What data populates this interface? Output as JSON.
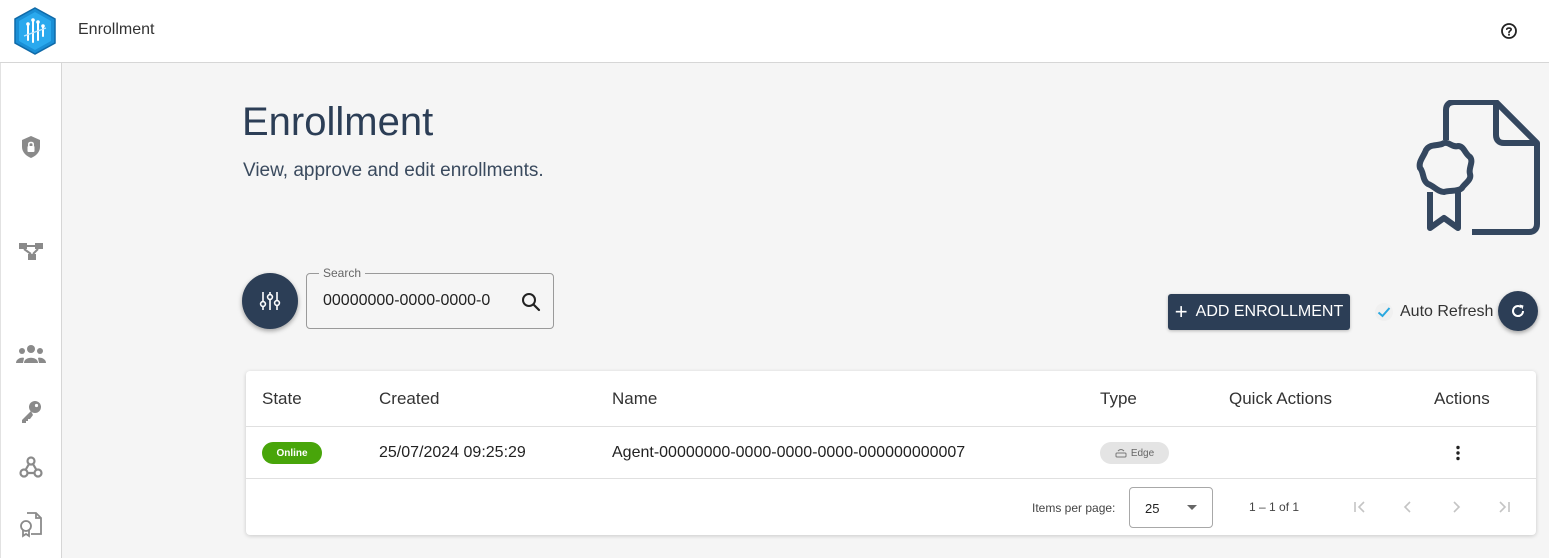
{
  "topbar": {
    "app_title": "Enrollment"
  },
  "page": {
    "title": "Enrollment",
    "subtitle": "View, approve and edit enrollments."
  },
  "search": {
    "label": "Search",
    "value": "00000000-0000-0000-0"
  },
  "toolbar": {
    "add_label": "ADD ENROLLMENT",
    "auto_refresh_label": "Auto Refresh",
    "auto_refresh_checked": true
  },
  "table": {
    "columns": [
      "State",
      "Created",
      "Name",
      "Type",
      "Quick Actions",
      "Actions"
    ],
    "rows": [
      {
        "state": "Online",
        "created": "25/07/2024 09:25:29",
        "name": "Agent-00000000-0000-0000-0000-000000000007",
        "type": "Edge"
      }
    ]
  },
  "paginator": {
    "items_per_page_label": "Items per page:",
    "page_size": "25",
    "range": "1 – 1 of 1"
  },
  "colors": {
    "primary": "#2c3e56",
    "online": "#48a50a",
    "background": "#f5f5f5"
  },
  "icons": {
    "sidebar": [
      "shield-lock-icon",
      "network-nodes-icon",
      "users-icon",
      "key-icon",
      "webhook-icon",
      "certificate-icon"
    ]
  }
}
